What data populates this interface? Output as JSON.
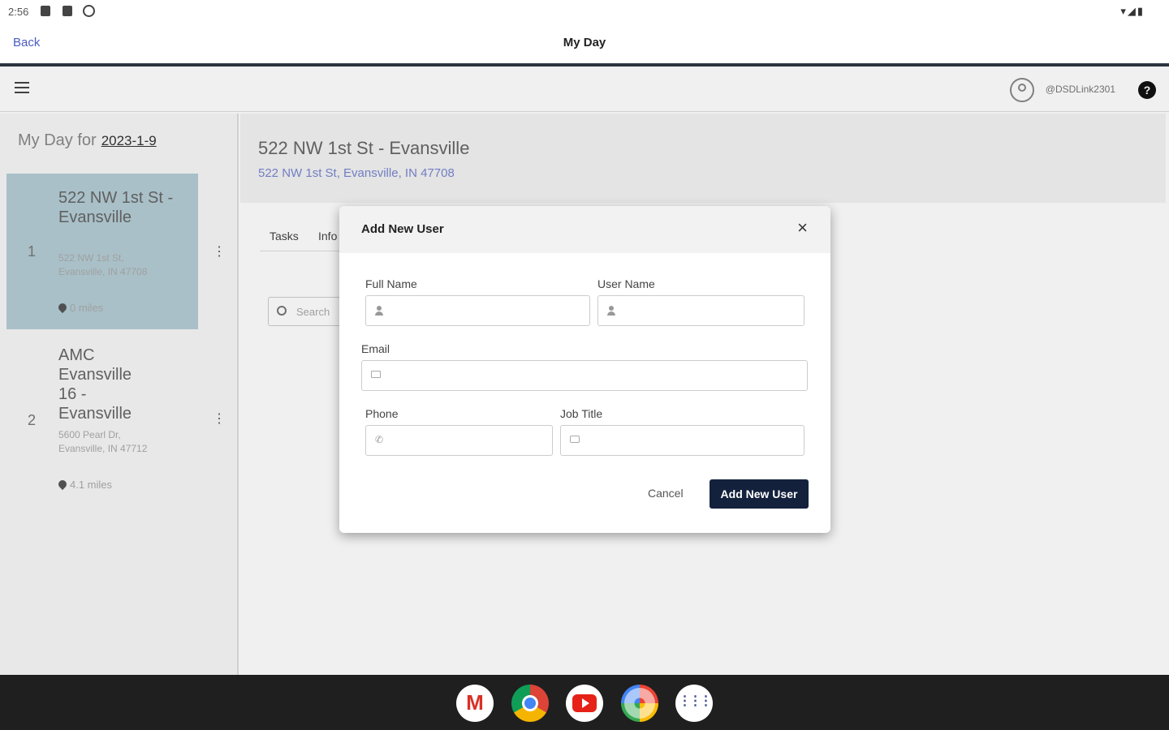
{
  "status_bar": {
    "time": "2:56",
    "right_icons": "▾◢▮"
  },
  "app_header": {
    "back": "Back",
    "title": "My Day"
  },
  "topbar": {
    "username": "@DSDLink2301",
    "help": "?"
  },
  "sidebar": {
    "heading_prefix": "My Day for",
    "date": "2023-1-9",
    "stops": [
      {
        "number": "1",
        "name": "522 NW 1st St - Evansville",
        "address": "522 NW 1st St, Evansville, IN 47708",
        "distance": "0 miles"
      },
      {
        "number": "2",
        "name": "AMC Evansville 16 - Evansville",
        "address": "5600 Pearl Dr, Evansville, IN 47712",
        "distance": "4.1 miles"
      }
    ]
  },
  "main": {
    "title": "522 NW 1st St - Evansville",
    "subtitle": "522 NW 1st St, Evansville, IN 47708",
    "tabs": [
      "Tasks",
      "Info"
    ],
    "search_placeholder": "Search"
  },
  "dialog": {
    "title": "Add New User",
    "close": "×",
    "fields": {
      "full_name": {
        "label": "Full Name",
        "value": ""
      },
      "user_name": {
        "label": "User Name",
        "value": ""
      },
      "email": {
        "label": "Email",
        "value": ""
      },
      "phone": {
        "label": "Phone",
        "value": ""
      },
      "job_title": {
        "label": "Job Title",
        "value": ""
      }
    },
    "cancel": "Cancel",
    "submit": "Add New User"
  },
  "dock": [
    "gmail",
    "chrome",
    "youtube",
    "photos",
    "apps"
  ],
  "colors": {
    "primary_button": "#14213d",
    "link": "#4a5cc0",
    "active_stop": "#b4cdd5"
  }
}
